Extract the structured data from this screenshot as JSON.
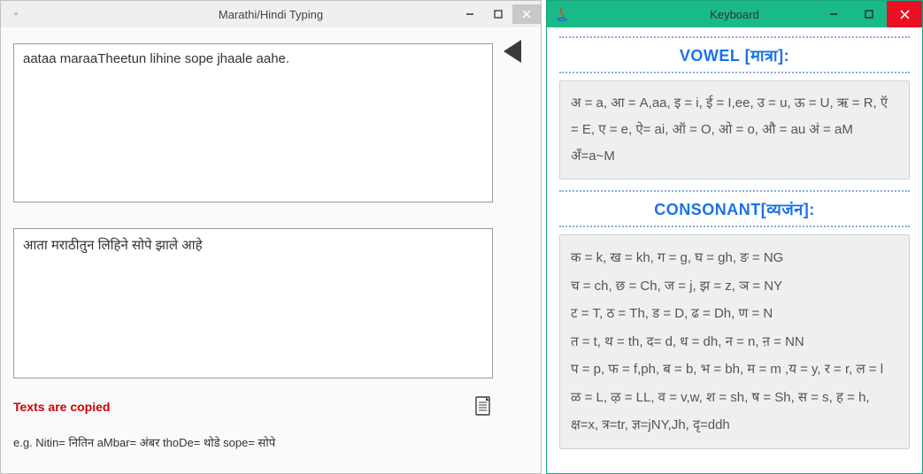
{
  "left": {
    "title": "Marathi/Hindi Typing",
    "input_value": "aataa maraaTheetun lihine sope jhaale aahe.",
    "output_value": "आता मराठीतुन लिहिने सोपे झाले आहे",
    "status": "Texts are copied",
    "example": "e.g. Nitin= नितिन  aMbar= अंबर   thoDe= थोडे   sope= सोपे"
  },
  "right": {
    "title": "Keyboard",
    "vowel_heading": "VOWEL [मात्रा]:",
    "vowel_body": "अ = a, आ = A,aa, इ = i, ई = I,ee, उ = u, ऊ = U, ऋ = R, ऍ = E, ए = e, ऐ= ai, ऑ = O, ओ = o, औ = au अं = aM अँ=a~M",
    "consonant_heading": "CONSONANT[व्यजंन]:",
    "consonant_body": "क = k, ख = kh, ग = g, घ = gh, ङ = NG\nच = ch, छ = Ch, ज = j, झ = z, ञ = NY\nट = T, ठ = Th, ड = D, ढ = Dh, ण = N\nत = t, थ = th, द= d, ध = dh, न = n, ऩ = NN\nप = p, फ = f,ph, ब = b, भ = bh, म = m ,य = y, र = r, ल = l\nळ = L, ऴ = LL, व = v,w, श = sh, ष = Sh, स = s, ह = h, क्ष=x, त्र=tr, ज्ञ=jNY,Jh, दृ=ddh"
  }
}
